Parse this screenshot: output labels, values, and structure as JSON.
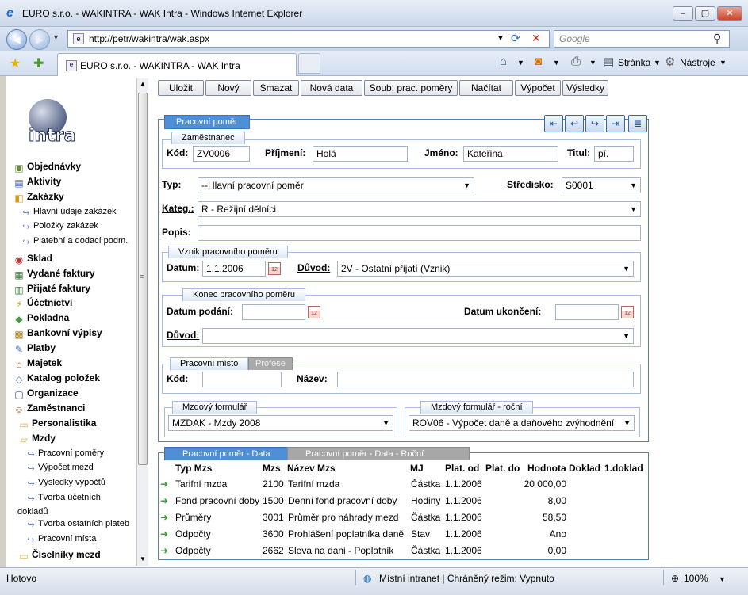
{
  "window": {
    "title": "EURO s.r.o. - WAKINTRA - WAK Intra - Windows Internet Explorer"
  },
  "browser": {
    "url": "http://petr/wakintra/wak.aspx",
    "search_placeholder": "Google",
    "tab_title": "EURO s.r.o. - WAKINTRA - WAK Intra",
    "cmd_page": "Stránka",
    "cmd_tools": "Nástroje"
  },
  "sidebar": {
    "logo_text": "intra",
    "items": [
      {
        "label": "Objednávky",
        "icon": "orders-icon",
        "type": "bold"
      },
      {
        "label": "Aktivity",
        "icon": "activities-icon",
        "type": "bold"
      },
      {
        "label": "Zakázky",
        "icon": "jobs-icon",
        "type": "bold"
      },
      {
        "label": "Hlavní údaje zakázek",
        "icon": "arrow-icon",
        "type": "sub"
      },
      {
        "label": "Položky zakázek",
        "icon": "arrow-icon",
        "type": "sub"
      },
      {
        "label": "Platební a dodací podm.",
        "icon": "arrow-icon",
        "type": "sub"
      },
      {
        "label": "Sklad",
        "icon": "warehouse-icon",
        "type": "bold"
      },
      {
        "label": "Vydané faktury",
        "icon": "invoice-out-icon",
        "type": "bold"
      },
      {
        "label": "Přijaté faktury",
        "icon": "invoice-in-icon",
        "type": "bold"
      },
      {
        "label": "Účetnictví",
        "icon": "accounting-icon",
        "type": "bold"
      },
      {
        "label": "Pokladna",
        "icon": "cash-icon",
        "type": "bold"
      },
      {
        "label": "Bankovní výpisy",
        "icon": "bank-icon",
        "type": "bold"
      },
      {
        "label": "Platby",
        "icon": "payments-icon",
        "type": "bold"
      },
      {
        "label": "Majetek",
        "icon": "assets-icon",
        "type": "bold"
      },
      {
        "label": "Katalog položek",
        "icon": "catalog-icon",
        "type": "bold"
      },
      {
        "label": "Organizace",
        "icon": "organization-icon",
        "type": "bold"
      },
      {
        "label": "Zaměstnanci",
        "icon": "employees-icon",
        "type": "bold"
      },
      {
        "label": "Personalistika",
        "icon": "folder-icon",
        "type": "bold"
      },
      {
        "label": "Mzdy",
        "icon": "folder-open-icon",
        "type": "bold"
      },
      {
        "label": "Pracovní poměry",
        "icon": "arrow-icon",
        "type": "sub"
      },
      {
        "label": "Výpočet mezd",
        "icon": "arrow-icon",
        "type": "sub"
      },
      {
        "label": "Výsledky výpočtů",
        "icon": "arrow-icon",
        "type": "sub"
      },
      {
        "label": "Tvorba účetních",
        "icon": "arrow-icon",
        "type": "sub"
      },
      {
        "label": "dokladů",
        "icon": "",
        "type": "sub"
      },
      {
        "label": "Tvorba ostatních plateb",
        "icon": "arrow-icon",
        "type": "sub"
      },
      {
        "label": "Pracovní místa",
        "icon": "arrow-icon",
        "type": "sub"
      },
      {
        "label": "Číselníky mezd",
        "icon": "folder-icon",
        "type": "bold"
      }
    ]
  },
  "toolbar": {
    "buttons": [
      "Uložit",
      "Nový",
      "Smazat",
      "Nová data",
      "Soub. prac. poměry",
      "Načítat",
      "Výpočet",
      "Výsledky"
    ]
  },
  "form": {
    "panel_tab": "Pracovní poměr",
    "employee": {
      "group_label": "Zaměstnanec",
      "kod_label": "Kód:",
      "kod_value": "ZV0006",
      "prijmeni_label": "Příjmení:",
      "prijmeni_value": "Holá",
      "jmeno_label": "Jméno:",
      "jmeno_value": "Kateřina",
      "titul_label": "Titul:",
      "titul_value": "pí."
    },
    "typ_label": "Typ:",
    "typ_value": "--Hlavní pracovní poměr",
    "stredisko_label": "Středisko:",
    "stredisko_value": "S0001",
    "kateg_label": "Kateg.:",
    "kateg_value": "R - Režijní dělníci",
    "popis_label": "Popis:",
    "popis_value": "",
    "vznik": {
      "group_label": "Vznik pracovního poměru",
      "datum_label": "Datum:",
      "datum_value": "1.1.2006",
      "duvod_label": "Důvod:",
      "duvod_value": "2V - Ostatní přijatí (Vznik)"
    },
    "konec": {
      "group_label": "Konec pracovního poměru",
      "podani_label": "Datum podání:",
      "podani_value": "",
      "ukonceni_label": "Datum ukončení:",
      "ukonceni_value": "",
      "duvod_label": "Důvod:",
      "duvod_value": ""
    },
    "misto": {
      "tab_active": "Pracovní místo",
      "tab_inactive": "Profese",
      "kod_label": "Kód:",
      "kod_value": "",
      "nazev_label": "Název:",
      "nazev_value": ""
    },
    "mzdovy": {
      "group_label": "Mzdový formulář",
      "value": "MZDAK - Mzdy 2008"
    },
    "mzdovy_rocni": {
      "group_label": "Mzdový formulář - roční",
      "value": "ROV06 - Výpočet daně a daňového zvýhodnění"
    }
  },
  "grid": {
    "tab_active": "Pracovní poměr - Data",
    "tab_inactive": "Pracovní poměr - Data - Roční",
    "headers": [
      "Typ Mzs",
      "Mzs",
      "Název Mzs",
      "MJ",
      "Plat. od",
      "Plat. do",
      "Hodnota",
      "Doklad",
      "1.doklad"
    ],
    "rows": [
      {
        "typ": "Tarifní mzda",
        "mzs": "2100",
        "nazev": "Tarifní mzda",
        "mj": "Částka",
        "od": "1.1.2006",
        "do": "",
        "hodnota": "20 000,00"
      },
      {
        "typ": "Fond pracovní doby",
        "mzs": "1500",
        "nazev": "Denní fond pracovní doby",
        "mj": "Hodiny",
        "od": "1.1.2006",
        "do": "",
        "hodnota": "8,00"
      },
      {
        "typ": "Průměry",
        "mzs": "3001",
        "nazev": "Průměr pro náhrady mezd",
        "mj": "Částka",
        "od": "1.1.2006",
        "do": "",
        "hodnota": "58,50"
      },
      {
        "typ": "Odpočty",
        "mzs": "3600",
        "nazev": "Prohlášení poplatníka daně",
        "mj": "Stav",
        "od": "1.1.2006",
        "do": "",
        "hodnota": "Ano"
      },
      {
        "typ": "Odpočty",
        "mzs": "2662",
        "nazev": "Sleva na dani - Poplatník",
        "mj": "Částka",
        "od": "1.1.2006",
        "do": "",
        "hodnota": "0,00"
      }
    ]
  },
  "status": {
    "left": "Hotovo",
    "zone": "Místní intranet | Chráněný režim: Vypnuto",
    "zoom": "100%"
  },
  "colors": {
    "accent": "#4f8fd6",
    "panel_border": "#5a7fb5",
    "group_border": "#a7bde0"
  }
}
